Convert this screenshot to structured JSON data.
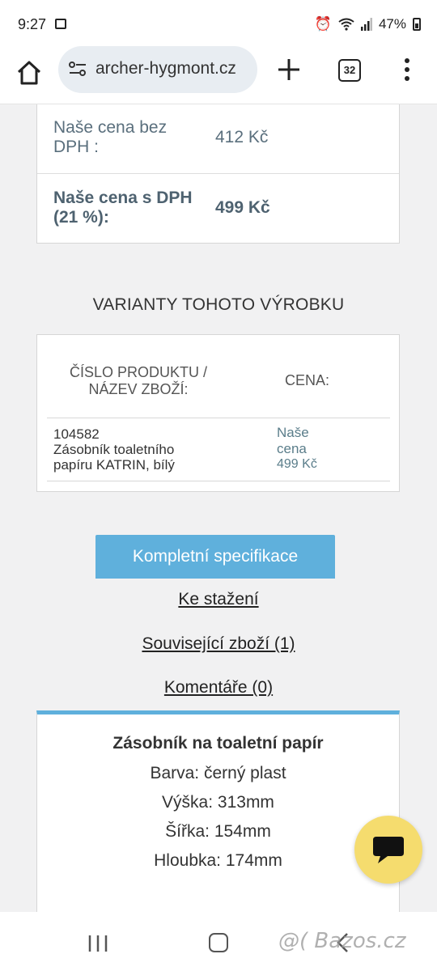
{
  "status_bar": {
    "time": "9:27",
    "battery": "47%"
  },
  "browser": {
    "url": "archer-hygmont.cz",
    "tab_count": "32"
  },
  "prices": [
    {
      "label": "Naše cena bez DPH :",
      "value": "412 Kč"
    },
    {
      "label": "Naše cena s DPH (21 %):",
      "value": "499 Kč"
    }
  ],
  "variants": {
    "title": "VARIANTY TOHOTO VÝROBKU",
    "header_product": "ČÍSLO PRODUKTU / NÁZEV ZBOŽÍ:",
    "header_price": "CENA:",
    "rows": [
      {
        "code": "104582",
        "name": "Zásobník toaletního papíru KATRIN, bílý",
        "price_label": "Naše cena",
        "price": "499 Kč"
      }
    ]
  },
  "actions": {
    "spec_button": "Kompletní specifikace",
    "downloads": "Ke stažení",
    "related": "Související zboží (1)",
    "comments": "Komentáře (0)"
  },
  "description": {
    "title": "Zásobník na toaletní papír",
    "lines": [
      "Barva: černý plast",
      "Výška: 313mm",
      "Šířka: 154mm",
      "Hloubka: 174mm"
    ]
  },
  "watermark": "@( Bazos.cz",
  "colors": {
    "accent": "#5fb0dc",
    "chat_button": "#f5dc6e",
    "price_text": "#5a6f7d"
  }
}
